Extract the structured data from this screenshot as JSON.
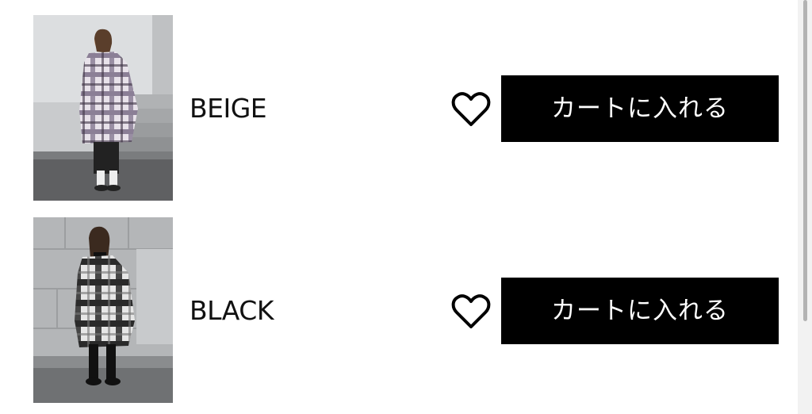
{
  "variants": [
    {
      "color": "BEIGE",
      "cart_label": "カートに入れる",
      "image_alt": "model wearing purple and white plaid shirt coat",
      "favorite_icon": "heart-outline-icon"
    },
    {
      "color": "BLACK",
      "cart_label": "カートに入れる",
      "image_alt": "model wearing black and white plaid shirt coat",
      "favorite_icon": "heart-outline-icon"
    }
  ],
  "colors": {
    "button_bg": "#000000",
    "button_text": "#ffffff",
    "label_text": "#111111",
    "coat_beige_plaid": "#8a7896",
    "coat_black_plaid": "#333333"
  }
}
